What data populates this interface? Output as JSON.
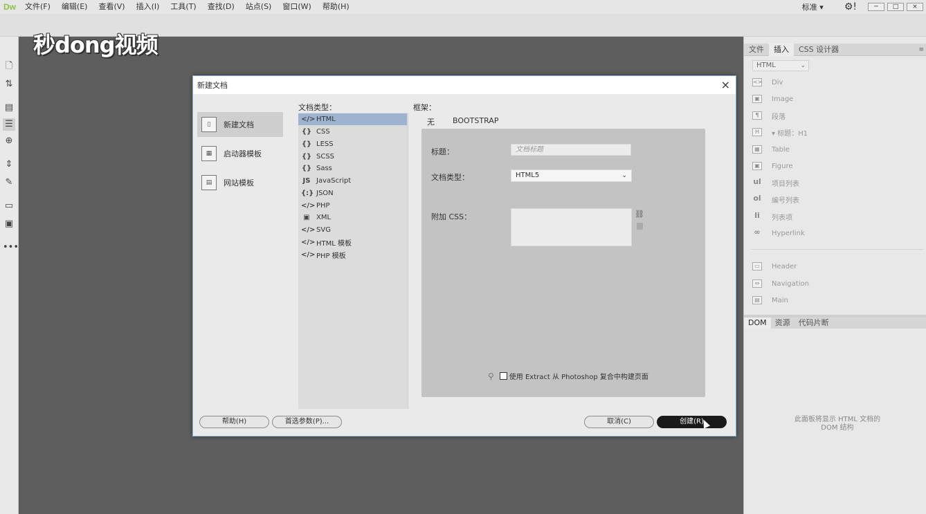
{
  "app": {
    "logo": "Dw"
  },
  "menubar": {
    "items": [
      "文件(F)",
      "编辑(E)",
      "查看(V)",
      "插入(I)",
      "工具(T)",
      "查找(D)",
      "站点(S)",
      "窗口(W)",
      "帮助(H)"
    ],
    "workspace": "标准 ▾",
    "gear_icon": "⚙!"
  },
  "watermark": {
    "text": "秒dong视频"
  },
  "left_toolbar": {
    "icons": [
      "file-icon",
      "sort-icon",
      "inspect-icon",
      "list-icon",
      "target-icon",
      "expand-icon",
      "brush-icon",
      "comment-icon",
      "comment-check-icon",
      "more-icon"
    ],
    "more": "•••"
  },
  "right_panel": {
    "tabs": [
      "文件",
      "插入",
      "CSS 设计器"
    ],
    "active_tab": "插入",
    "insert_select": "HTML",
    "items": [
      {
        "icon": "<>",
        "label": "Div"
      },
      {
        "icon": "▣",
        "label": "Image"
      },
      {
        "icon": "¶",
        "label": "段落"
      },
      {
        "icon": "H",
        "label": "▾ 标题：H1"
      },
      {
        "icon": "▦",
        "label": "Table"
      },
      {
        "icon": "▣",
        "label": "Figure"
      },
      {
        "icon": "ul",
        "label": "项目列表"
      },
      {
        "icon": "ol",
        "label": "编号列表"
      },
      {
        "icon": "li",
        "label": "列表项"
      },
      {
        "icon": "∞",
        "label": "Hyperlink"
      }
    ],
    "items2": [
      {
        "icon": "▭",
        "label": "Header"
      },
      {
        "icon": "⇔",
        "label": "Navigation"
      },
      {
        "icon": "▤",
        "label": "Main"
      }
    ],
    "dom_tabs": [
      "DOM",
      "资源",
      "代码片断"
    ],
    "dom_message": "此面板将显示 HTML 文档的 DOM 结构"
  },
  "dialog": {
    "title": "新建文档",
    "close": "×",
    "categories": [
      {
        "label": "新建文档",
        "icon": "▯"
      },
      {
        "label": "启动器模板",
        "icon": "▦"
      },
      {
        "label": "网站模板",
        "icon": "▤"
      }
    ],
    "doctype_label": "文档类型：",
    "doctypes": [
      {
        "icon": "</>",
        "label": "HTML"
      },
      {
        "icon": "{}",
        "label": "CSS"
      },
      {
        "icon": "{}",
        "label": "LESS"
      },
      {
        "icon": "{}",
        "label": "SCSS"
      },
      {
        "icon": "{}",
        "label": "Sass"
      },
      {
        "icon": "JS",
        "label": "JavaScript"
      },
      {
        "icon": "{:}",
        "label": "JSON"
      },
      {
        "icon": "</>",
        "label": "PHP"
      },
      {
        "icon": "▣",
        "label": "XML"
      },
      {
        "icon": "</>",
        "label": "SVG"
      },
      {
        "icon": "</>",
        "label": "HTML 模板"
      },
      {
        "icon": "</>",
        "label": "PHP 模板"
      }
    ],
    "framework_label": "框架：",
    "framework_tabs": [
      "无",
      "BOOTSTRAP"
    ],
    "title_label": "标题：",
    "title_placeholder": "文档标题",
    "doctype_field_label": "文档类型：",
    "doctype_value": "HTML5",
    "attach_css_label": "附加 CSS：",
    "extract_label": "使用 Extract 从 Photoshop 复合中构建页面",
    "help_button": "帮助(H)",
    "prefs_button": "首选参数(P)...",
    "cancel_button": "取消(C)",
    "create_button": "创建(R)"
  }
}
